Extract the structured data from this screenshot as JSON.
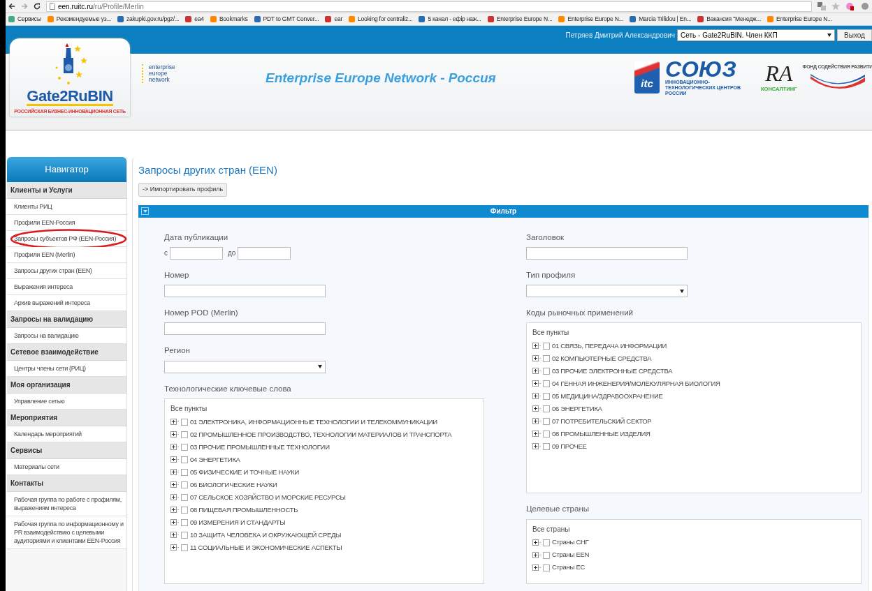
{
  "browser": {
    "url_host": "een.ruitc.ru",
    "url_path": "/ru/Profile/Merlin",
    "bookmarks": [
      {
        "label": "Сервисы"
      },
      {
        "label": "Рекомендуемые уз..."
      },
      {
        "label": "zakupki.gov.ru/pgz/..."
      },
      {
        "label": "ea4"
      },
      {
        "label": "Bookmarks"
      },
      {
        "label": "PDT to GMT Conver..."
      },
      {
        "label": "ear"
      },
      {
        "label": "Looking for centraliz..."
      },
      {
        "label": "5 канал - ефір наж..."
      },
      {
        "label": "Enterprise Europe N..."
      },
      {
        "label": "Enterprise Europe N..."
      },
      {
        "label": "Marcia Trilidou | En..."
      },
      {
        "label": "Вакансия \"Менедж..."
      },
      {
        "label": "Enterprise Europe N..."
      }
    ]
  },
  "header": {
    "user_name": "Петряев Дмитрий Александрович",
    "network_select": "Сеть - Gate2RuBIN. Член ККП",
    "logout_button": "Выход",
    "logo": {
      "name": "Gate2RuBIN",
      "tagline": "РОССИЙСКАЯ БИЗНЕС-ИННОВАЦИОННАЯ СЕТЬ"
    },
    "een_logo": [
      "enterprise",
      "europe",
      "network"
    ],
    "site_title": "Enterprise Europe Network - Россия",
    "partners": {
      "itc": "itc",
      "soyuz": "СОЮЗ",
      "soyuz_sub": "ИННОВАЦИОННО-ТЕХНОЛОГИЧЕСКИХ ЦЕНТРОВ РОССИИ",
      "ra": "RA",
      "ra_sub": "КОНСАЛТИНГ",
      "fund": "ФОНД СОДЕЙСТВИЯ РАЗВИТИ"
    }
  },
  "sidebar": {
    "title": "Навигатор",
    "groups": [
      {
        "title": "Клиенты и Услуги",
        "items": [
          {
            "label": "Клиенты РИЦ",
            "highlighted": false
          },
          {
            "label": "Профили EEN-Россия",
            "highlighted": false
          },
          {
            "label": "Запросы субъектов РФ (EEN-Россия)",
            "highlighted": true
          },
          {
            "label": "Профили EEN (Merlin)",
            "highlighted": false
          },
          {
            "label": "Запросы других стран (EEN)",
            "highlighted": false
          },
          {
            "label": "Выражения интереса",
            "highlighted": false
          },
          {
            "label": "Архив выражений интереса",
            "highlighted": false
          }
        ]
      },
      {
        "title": "Запросы на валидацию",
        "items": [
          {
            "label": "Запросы на валидацию",
            "highlighted": false
          }
        ]
      },
      {
        "title": "Сетевое взаимодействие",
        "items": [
          {
            "label": "Центры члены сети (РИЦ)",
            "highlighted": false
          }
        ]
      },
      {
        "title": "Моя организация",
        "items": [
          {
            "label": "Управление сетью",
            "highlighted": false
          }
        ]
      },
      {
        "title": "Мероприятия",
        "items": [
          {
            "label": "Календарь мероприятий",
            "highlighted": false
          }
        ]
      },
      {
        "title": "Сервисы",
        "items": [
          {
            "label": "Материалы сети",
            "highlighted": false
          }
        ]
      },
      {
        "title": "Контакты",
        "items": [
          {
            "label": "Рабочая группа по работе с профилям, выражениям интереса",
            "highlighted": false
          },
          {
            "label": "Рабочая группа по информационному и PR взаимодействию с целевыми аудиториями и клиентами EEN-Россия",
            "highlighted": false
          }
        ]
      }
    ]
  },
  "content": {
    "title": "Запросы других стран (EEN)",
    "import_button": "-> Импортировать профиль",
    "filter": {
      "title": "Фильтр",
      "expanded": true,
      "left": [
        {
          "kind": "date_range",
          "label": "Дата публикации",
          "from_label": "с",
          "to_label": "до"
        },
        {
          "kind": "text",
          "label": "Номер"
        },
        {
          "kind": "text",
          "label": "Номер POD (Merlin)"
        },
        {
          "kind": "select",
          "label": "Регион"
        },
        {
          "kind": "tree",
          "label": "Технологические ключевые слова",
          "root": "Все пункты",
          "items": [
            {
              "label": "01 ЭЛЕКТРОНИКА, ИНФОРМАЦИОННЫЕ ТЕХНОЛОГИИ И ТЕЛЕКОММУНИКАЦИИ",
              "checked": false,
              "expanded": false
            },
            {
              "label": "02 ПРОМЫШЛЕННОЕ ПРОИЗВОДСТВО, ТЕХНОЛОГИИ МАТЕРИАЛОВ И ТРАНСПОРТА",
              "checked": false,
              "expanded": false
            },
            {
              "label": "03 ПРОЧИЕ ПРОМЫШЛЕННЫЕ ТЕХНОЛОГИИ",
              "checked": false,
              "expanded": false
            },
            {
              "label": "04 ЭНЕРГЕТИКА",
              "checked": false,
              "expanded": false
            },
            {
              "label": "05 ФИЗИЧЕСКИЕ И ТОЧНЫЕ НАУКИ",
              "checked": false,
              "expanded": false
            },
            {
              "label": "06 БИОЛОГИЧЕСКИЕ НАУКИ",
              "checked": false,
              "expanded": false
            },
            {
              "label": "07 СЕЛЬСКОЕ ХОЗЯЙСТВО И МОРСКИЕ РЕСУРСЫ",
              "checked": false,
              "expanded": false
            },
            {
              "label": "08 ПИЩЕВАЯ ПРОМЫШЛЕННОСТЬ",
              "checked": false,
              "expanded": false
            },
            {
              "label": "09 ИЗМЕРЕНИЯ И СТАНДАРТЫ",
              "checked": false,
              "expanded": false
            },
            {
              "label": "10 ЗАЩИТА ЧЕЛОВЕКА И ОКРУЖАЮЩЕЙ СРЕДЫ",
              "checked": false,
              "expanded": false
            },
            {
              "label": "11 СОЦИАЛЬНЫЕ И ЭКОНОМИЧЕСКИЕ АСПЕКТЫ",
              "checked": false,
              "expanded": false
            }
          ]
        }
      ],
      "right": [
        {
          "kind": "text",
          "label": "Заголовок"
        },
        {
          "kind": "select",
          "label": "Тип профиля"
        },
        {
          "kind": "tree",
          "label": "Коды рыночных применений",
          "root": "Все пункты",
          "items": [
            {
              "label": "01 СВЯЗЬ, ПЕРЕДАЧА ИНФОРМАЦИИ",
              "checked": false,
              "expanded": false
            },
            {
              "label": "02 КОМПЬЮТЕРНЫЕ СРЕДСТВА",
              "checked": false,
              "expanded": false
            },
            {
              "label": "03 ПРОЧИЕ ЭЛЕКТРОННЫЕ СРЕДСТВА",
              "checked": false,
              "expanded": false
            },
            {
              "label": "04 ГЕННАЯ ИНЖЕНЕРИЯ/МОЛЕКУЛЯРНАЯ БИОЛОГИЯ",
              "checked": false,
              "expanded": false
            },
            {
              "label": "05 МЕДИЦИНА/ЗДРАВООХРАНЕНИЕ",
              "checked": false,
              "expanded": false
            },
            {
              "label": "06 ЭНЕРГЕТИКА",
              "checked": false,
              "expanded": false
            },
            {
              "label": "07 ПОТРЕБИТЕЛЬСКИЙ СЕКТОР",
              "checked": false,
              "expanded": false
            },
            {
              "label": "08 ПРОМЫШЛЕННЫЕ ИЗДЕЛИЯ",
              "checked": false,
              "expanded": false
            },
            {
              "label": "09 ПРОЧЕЕ",
              "checked": false,
              "expanded": false
            }
          ]
        },
        {
          "kind": "tree",
          "label": "Целевые страны",
          "root": "Все страны",
          "items": [
            {
              "label": "Страны СНГ",
              "checked": false,
              "expanded": false
            },
            {
              "label": "Страны EEN",
              "checked": false,
              "expanded": false
            },
            {
              "label": "Страны ЕС",
              "checked": false,
              "expanded": false
            }
          ]
        }
      ]
    }
  }
}
